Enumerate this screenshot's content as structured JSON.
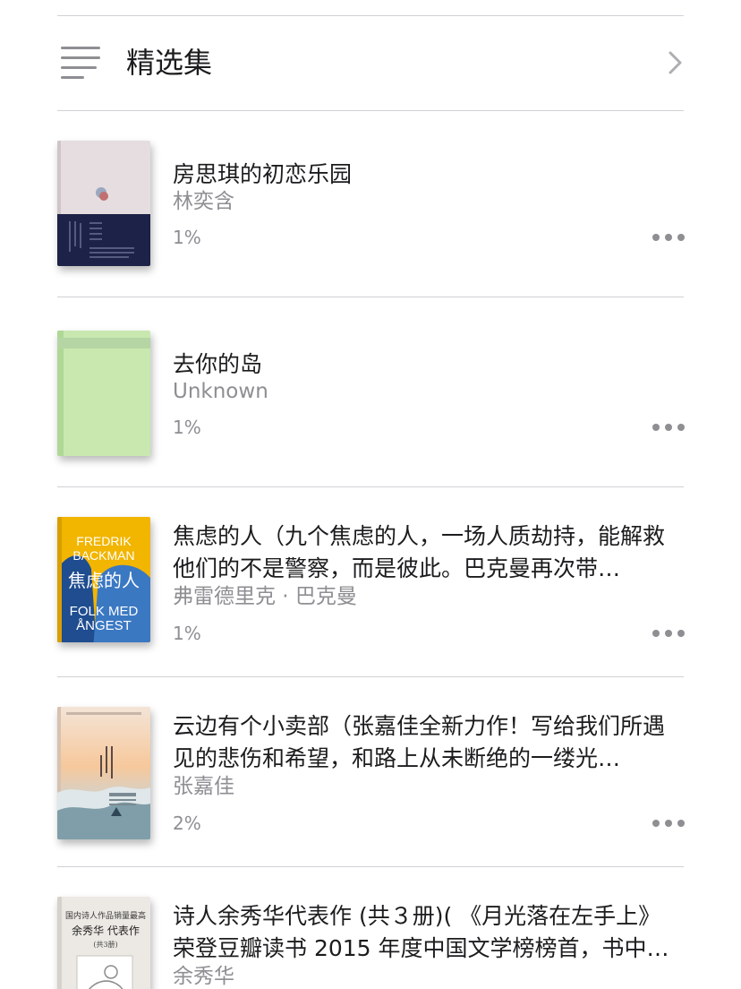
{
  "header": {
    "title": "精选集",
    "list_icon": "list-icon",
    "chevron_icon": "chevron-right-icon"
  },
  "books": [
    {
      "title": "房思琪的初恋乐园",
      "author": "林奕含",
      "progress": "1%",
      "more_icon": "more-icon"
    },
    {
      "title": "去你的岛",
      "author": "Unknown",
      "progress": "1%",
      "more_icon": "more-icon"
    },
    {
      "title": "焦虑的人（九个焦虑的人，一场人质劫持，能解救他们的不是警察，而是彼此。巴克曼再次带…",
      "author": "弗雷德里克 · 巴克曼",
      "progress": "1%",
      "more_icon": "more-icon",
      "cover_text": {
        "line1": "FREDRIK",
        "line2": "BACKMAN",
        "line3": "焦虑的人",
        "line4": "FOLK MED",
        "line5": "ÅNGEST"
      }
    },
    {
      "title": "云边有个小卖部（张嘉佳全新力作！写给我们所遇见的悲伤和希望，和路上从未断绝的一缕光…",
      "author": "张嘉佳",
      "progress": "2%",
      "more_icon": "more-icon"
    },
    {
      "title": "诗人余秀华代表作 (共３册)( 《月光落在左手上》荣登豆瓣读书 2015 年度中国文学榜榜首，书中…",
      "author": "余秀华",
      "progress": "",
      "more_icon": "more-icon",
      "cover_text": {
        "line1": "国内诗人作品销量最高",
        "line2": "余秀华 代表作",
        "line3": "(共3册)"
      }
    }
  ],
  "colors": {
    "separator": "#d1d1d6",
    "secondary_text": "#8e8e93",
    "primary_text": "#1c1c1e"
  }
}
